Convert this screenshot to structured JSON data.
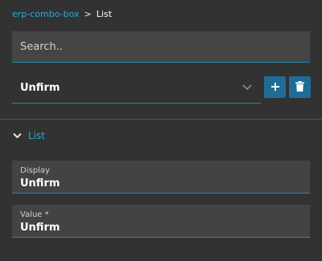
{
  "breadcrumb": {
    "parent": "erp-combo-box",
    "separator": ">",
    "current": "List"
  },
  "search": {
    "placeholder": "Search..",
    "value": ""
  },
  "select": {
    "selected_value": "Unfirm"
  },
  "buttons": {
    "add_icon": "plus-icon",
    "delete_icon": "trash-icon"
  },
  "section": {
    "title": "List",
    "expanded": true
  },
  "fields": {
    "display": {
      "label": "Display",
      "value": "Unfirm"
    },
    "value": {
      "label": "Value *",
      "value": "Unfirm"
    }
  },
  "colors": {
    "background": "#323232",
    "accent": "#2ea8d6",
    "button": "#1e6d96",
    "field_bg": "#434343"
  }
}
